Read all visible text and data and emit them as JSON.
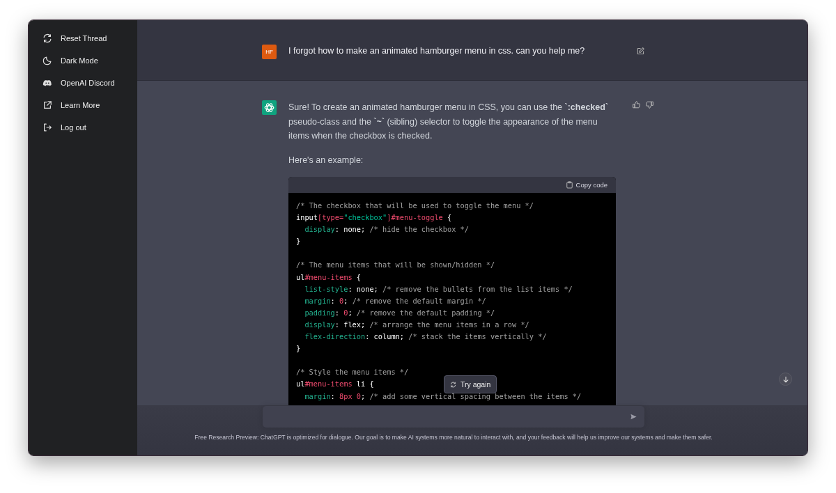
{
  "sidebar": {
    "items": [
      {
        "kind": "refresh",
        "label": "Reset Thread"
      },
      {
        "kind": "moon",
        "label": "Dark Mode"
      },
      {
        "kind": "discord",
        "label": "OpenAI Discord"
      },
      {
        "kind": "external",
        "label": "Learn More"
      },
      {
        "kind": "logout",
        "label": "Log out"
      }
    ]
  },
  "user_message": {
    "avatar": "HF",
    "text": "I forgot how to make an animated hamburger menu in css. can you help me?"
  },
  "assistant_message": {
    "paragraphs": [
      "Sure! To create an animated hamburger menu in CSS, you can use the **`:checked`** pseudo-class and the **`~`** (sibling) selector to toggle the appearance of the menu items when the checkbox is checked.",
      "Here's an example:"
    ],
    "code_block": {
      "copy_label": "Copy code",
      "sections": [
        {
          "lines": [
            {
              "tokens": [
                {
                  "kind": "comment",
                  "text": "/* The checkbox that will be used to toggle the menu */"
                }
              ]
            },
            {
              "tokens": [
                {
                  "kind": "plain",
                  "text": "input"
                },
                {
                  "kind": "selector",
                  "text": "[type="
                },
                {
                  "kind": "string",
                  "text": "\"checkbox\""
                },
                {
                  "kind": "selector",
                  "text": "]#menu-toggle"
                },
                {
                  "kind": "plain",
                  "text": " {"
                }
              ]
            },
            {
              "tokens": [
                {
                  "kind": "prop",
                  "text": "  display"
                },
                {
                  "kind": "plain",
                  "text": ": none; "
                },
                {
                  "kind": "comment",
                  "text": "/* hide the checkbox */"
                }
              ]
            },
            {
              "tokens": [
                {
                  "kind": "plain",
                  "text": "}"
                }
              ]
            }
          ]
        },
        {
          "lines": [
            {
              "tokens": [
                {
                  "kind": "comment",
                  "text": "/* The menu items that will be shown/hidden */"
                }
              ]
            },
            {
              "tokens": [
                {
                  "kind": "plain",
                  "text": "ul"
                },
                {
                  "kind": "selector",
                  "text": "#menu-items"
                },
                {
                  "kind": "plain",
                  "text": " {"
                }
              ]
            },
            {
              "tokens": [
                {
                  "kind": "prop",
                  "text": "  list-style"
                },
                {
                  "kind": "plain",
                  "text": ": none; "
                },
                {
                  "kind": "comment",
                  "text": "/* remove the bullets from the list items */"
                }
              ]
            },
            {
              "tokens": [
                {
                  "kind": "prop",
                  "text": "  margin"
                },
                {
                  "kind": "plain",
                  "text": ": "
                },
                {
                  "kind": "number",
                  "text": "0"
                },
                {
                  "kind": "plain",
                  "text": "; "
                },
                {
                  "kind": "comment",
                  "text": "/* remove the default margin */"
                }
              ]
            },
            {
              "tokens": [
                {
                  "kind": "prop",
                  "text": "  padding"
                },
                {
                  "kind": "plain",
                  "text": ": "
                },
                {
                  "kind": "number",
                  "text": "0"
                },
                {
                  "kind": "plain",
                  "text": "; "
                },
                {
                  "kind": "comment",
                  "text": "/* remove the default padding */"
                }
              ]
            },
            {
              "tokens": [
                {
                  "kind": "prop",
                  "text": "  display"
                },
                {
                  "kind": "plain",
                  "text": ": flex; "
                },
                {
                  "kind": "comment",
                  "text": "/* arrange the menu items in a row */"
                }
              ]
            },
            {
              "tokens": [
                {
                  "kind": "prop",
                  "text": "  flex-direction"
                },
                {
                  "kind": "plain",
                  "text": ": column; "
                },
                {
                  "kind": "comment",
                  "text": "/* stack the items vertically */"
                }
              ]
            },
            {
              "tokens": [
                {
                  "kind": "plain",
                  "text": "}"
                }
              ]
            }
          ]
        },
        {
          "lines": [
            {
              "tokens": [
                {
                  "kind": "comment",
                  "text": "/* Style the menu items */"
                }
              ]
            },
            {
              "tokens": [
                {
                  "kind": "plain",
                  "text": "ul"
                },
                {
                  "kind": "selector",
                  "text": "#menu-items"
                },
                {
                  "kind": "plain",
                  "text": " li {"
                }
              ]
            },
            {
              "tokens": [
                {
                  "kind": "prop",
                  "text": "  margin"
                },
                {
                  "kind": "plain",
                  "text": ": "
                },
                {
                  "kind": "number",
                  "text": "8px 0"
                },
                {
                  "kind": "plain",
                  "text": "; "
                },
                {
                  "kind": "comment",
                  "text": "/* add some vertical spacing between the items */"
                }
              ]
            }
          ]
        }
      ]
    }
  },
  "try_again_label": "Try again",
  "footer": "Free Research Preview: ChatGPT is optimized for dialogue. Our goal is to make AI systems more natural to interact with, and your feedback will help us improve our systems and make them safer."
}
